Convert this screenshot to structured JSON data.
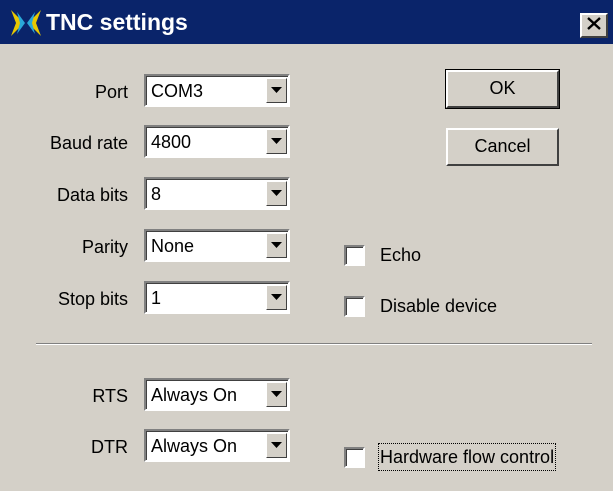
{
  "window": {
    "title": "TNC settings",
    "icon": "butterfly-app-icon",
    "close_glyph": "✕"
  },
  "fields": {
    "port": {
      "label": "Port",
      "value": "COM3"
    },
    "baud_rate": {
      "label": "Baud rate",
      "value": "4800"
    },
    "data_bits": {
      "label": "Data bits",
      "value": "8"
    },
    "parity": {
      "label": "Parity",
      "value": "None"
    },
    "stop_bits": {
      "label": "Stop bits",
      "value": "1"
    },
    "rts": {
      "label": "RTS",
      "value": "Always On"
    },
    "dtr": {
      "label": "DTR",
      "value": "Always On"
    }
  },
  "buttons": {
    "ok": "OK",
    "cancel": "Cancel"
  },
  "checkboxes": {
    "echo": {
      "label": "Echo",
      "checked": false
    },
    "disable_device": {
      "label": "Disable device",
      "checked": false
    },
    "hardware_flow_control": {
      "label": "Hardware flow control",
      "checked": false
    }
  },
  "colors": {
    "titlebar": "#0a246a",
    "face": "#d4d0c8",
    "icon_accent": "#e8c800"
  }
}
